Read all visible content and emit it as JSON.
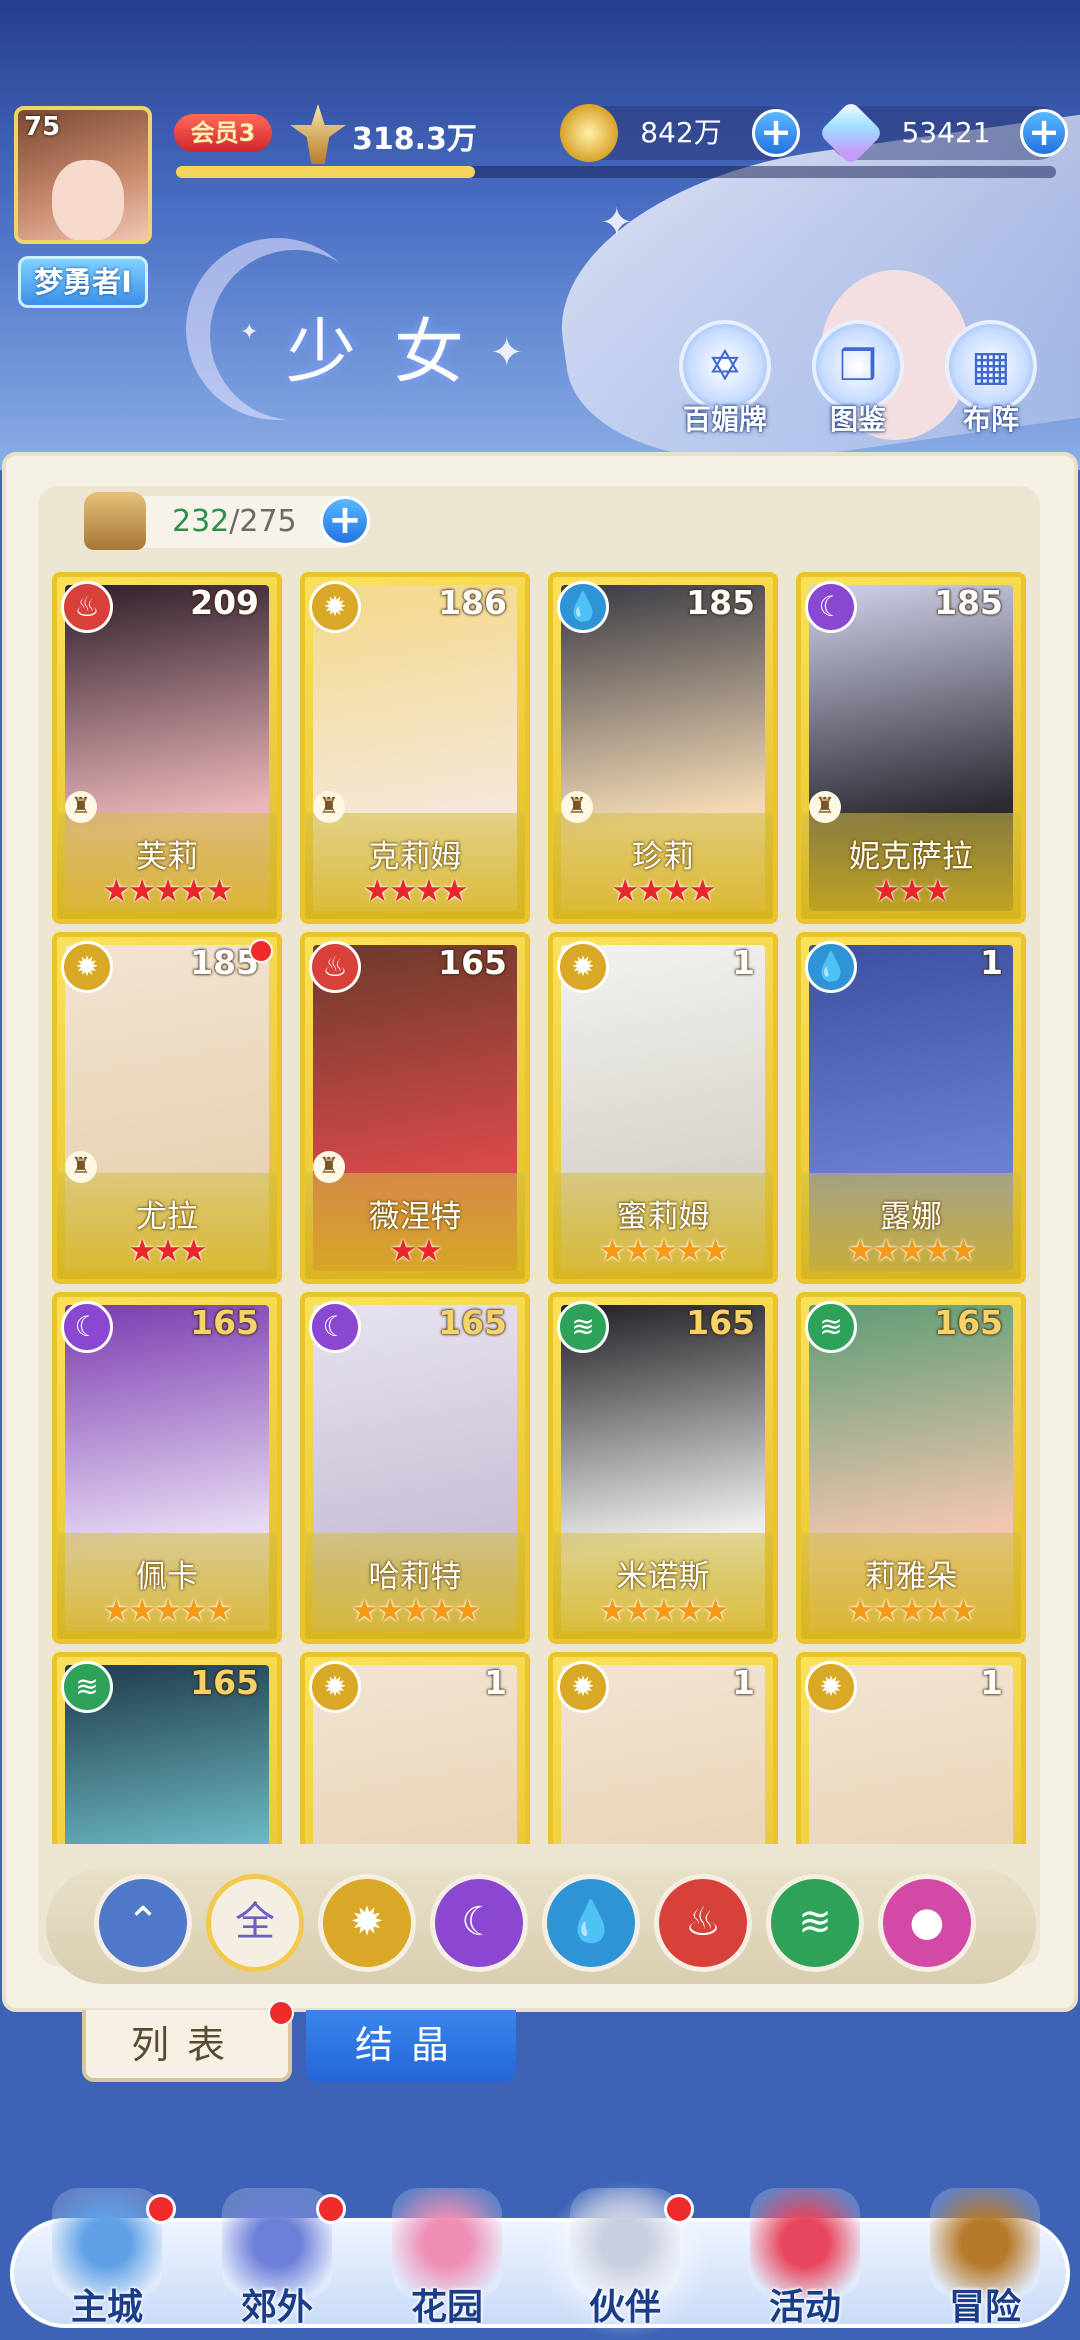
{
  "player": {
    "level": "75",
    "name": "梦勇者I",
    "vip": "会员3",
    "power": "318.3万",
    "exp_fraction": 0.34
  },
  "resources": {
    "gold": "842万",
    "diamond": "53421"
  },
  "page_title": "少女",
  "shortcuts": [
    {
      "label": "百媚牌",
      "icon": "hexagram-card-icon"
    },
    {
      "label": "图鉴",
      "icon": "book-icon"
    },
    {
      "label": "布阵",
      "icon": "grid-formation-icon"
    }
  ],
  "capacity": {
    "used": "232",
    "total": "/275"
  },
  "elements": {
    "fire": {
      "color": "#d8403a",
      "glyph": "♨"
    },
    "light": {
      "color": "#d9a826",
      "glyph": "✹"
    },
    "water": {
      "color": "#2f94d6",
      "glyph": "💧"
    },
    "moon": {
      "color": "#8a47d1",
      "glyph": "☾"
    },
    "wind": {
      "color": "#2fa25a",
      "glyph": "≋"
    }
  },
  "cards": [
    {
      "name": "芙莉",
      "level": "209",
      "element": "fire",
      "stars": 5,
      "star_color": "red",
      "badge": true,
      "dot": false,
      "art": [
        "#2e1e2a",
        "#e9b5b8"
      ]
    },
    {
      "name": "克莉姆",
      "level": "186",
      "element": "light",
      "stars": 4,
      "star_color": "red",
      "badge": true,
      "dot": false,
      "art": [
        "#f3d98a",
        "#f5e7d8"
      ]
    },
    {
      "name": "珍莉",
      "level": "185",
      "element": "water",
      "stars": 4,
      "star_color": "red",
      "badge": true,
      "dot": false,
      "art": [
        "#3a3a44",
        "#f2d9b4"
      ]
    },
    {
      "name": "妮克萨拉",
      "level": "185",
      "element": "moon",
      "stars": 3,
      "star_color": "red",
      "badge": true,
      "dot": false,
      "art": [
        "#cfd2ea",
        "#2c2a33"
      ]
    },
    {
      "name": "尤拉",
      "level": "185",
      "element": "light",
      "stars": 3,
      "star_color": "red",
      "badge": true,
      "dot": true,
      "art": [
        "#f2e4d2",
        "#e8d3b4"
      ]
    },
    {
      "name": "薇涅特",
      "level": "165",
      "element": "fire",
      "stars": 2,
      "star_color": "red",
      "badge": true,
      "dot": false,
      "art": [
        "#6b3b2a",
        "#d94a4a"
      ]
    },
    {
      "name": "蜜莉姆",
      "level": "1",
      "element": "light",
      "stars": 5,
      "star_color": "orange",
      "badge": false,
      "dot": false,
      "art": [
        "#f2f2f0",
        "#d9d4cb"
      ]
    },
    {
      "name": "露娜",
      "level": "1",
      "element": "water",
      "stars": 5,
      "star_color": "orange",
      "badge": false,
      "dot": false,
      "art": [
        "#3c4fa0",
        "#6c7fd4"
      ]
    },
    {
      "name": "佩卡",
      "level": "165",
      "element": "moon",
      "stars": 5,
      "star_color": "orange",
      "badge": false,
      "dot": false,
      "art": [
        "#7a3bb0",
        "#e6d9f2"
      ]
    },
    {
      "name": "哈莉特",
      "level": "165",
      "element": "moon",
      "stars": 5,
      "star_color": "orange",
      "badge": false,
      "dot": false,
      "art": [
        "#e7e2ef",
        "#c9c1d6"
      ]
    },
    {
      "name": "米诺斯",
      "level": "165",
      "element": "wind",
      "stars": 5,
      "star_color": "orange",
      "badge": false,
      "dot": false,
      "art": [
        "#1f1f24",
        "#ededed"
      ]
    },
    {
      "name": "莉雅朵",
      "level": "165",
      "element": "wind",
      "stars": 5,
      "star_color": "orange",
      "badge": false,
      "dot": false,
      "art": [
        "#5e9c74",
        "#f0c6b0"
      ]
    },
    {
      "name": "",
      "level": "165",
      "element": "wind",
      "stars": 0,
      "star_color": "orange",
      "badge": false,
      "dot": false,
      "art": [
        "#1f3a4a",
        "#7ad0d8"
      ]
    },
    {
      "name": "",
      "level": "1",
      "element": "light",
      "stars": 0,
      "star_color": "orange",
      "badge": false,
      "dot": false,
      "art": [
        "#f2e4d2",
        "#e8d3b4"
      ]
    },
    {
      "name": "",
      "level": "1",
      "element": "light",
      "stars": 0,
      "star_color": "orange",
      "badge": false,
      "dot": false,
      "art": [
        "#f2e4d2",
        "#e8d3b4"
      ]
    },
    {
      "name": "",
      "level": "1",
      "element": "light",
      "stars": 0,
      "star_color": "orange",
      "badge": false,
      "dot": false,
      "art": [
        "#f2e4d2",
        "#e8d3b4"
      ]
    }
  ],
  "filters": [
    {
      "key": "expand",
      "label": "⌃",
      "color": "#4f78c8",
      "name": "filter-expand-icon"
    },
    {
      "key": "all",
      "label": "全",
      "color": "#6a5fc4",
      "name": "filter-all-icon",
      "selected": true
    },
    {
      "key": "light",
      "label": "✹",
      "color": "#d9a826",
      "name": "filter-light-icon"
    },
    {
      "key": "moon",
      "label": "☾",
      "color": "#8a47d1",
      "name": "filter-moon-icon"
    },
    {
      "key": "water",
      "label": "💧",
      "color": "#2f94d6",
      "name": "filter-water-icon"
    },
    {
      "key": "fire",
      "label": "♨",
      "color": "#d8403a",
      "name": "filter-fire-icon"
    },
    {
      "key": "wind",
      "label": "≋",
      "color": "#2fa25a",
      "name": "filter-wind-icon"
    },
    {
      "key": "heart",
      "label": "●",
      "color": "#d24aa6",
      "name": "filter-heart-icon"
    }
  ],
  "tabs": {
    "list": "列表",
    "crystal": "结晶"
  },
  "nav": [
    {
      "label": "主城",
      "icon": "castle-icon",
      "dot": true,
      "color": "#5fa0e6"
    },
    {
      "label": "郊外",
      "icon": "magic-circle-icon",
      "dot": true,
      "color": "#6e7fd8"
    },
    {
      "label": "花园",
      "icon": "heart-garden-icon",
      "dot": false,
      "color": "#ef8fb6"
    },
    {
      "label": "伙伴",
      "icon": "partner-portrait-icon",
      "dot": true,
      "color": "#c9cfe0",
      "selected": true
    },
    {
      "label": "活动",
      "icon": "gift-box-icon",
      "dot": false,
      "color": "#e8465e"
    },
    {
      "label": "冒险",
      "icon": "compass-icon",
      "dot": false,
      "color": "#b67a2c"
    }
  ]
}
